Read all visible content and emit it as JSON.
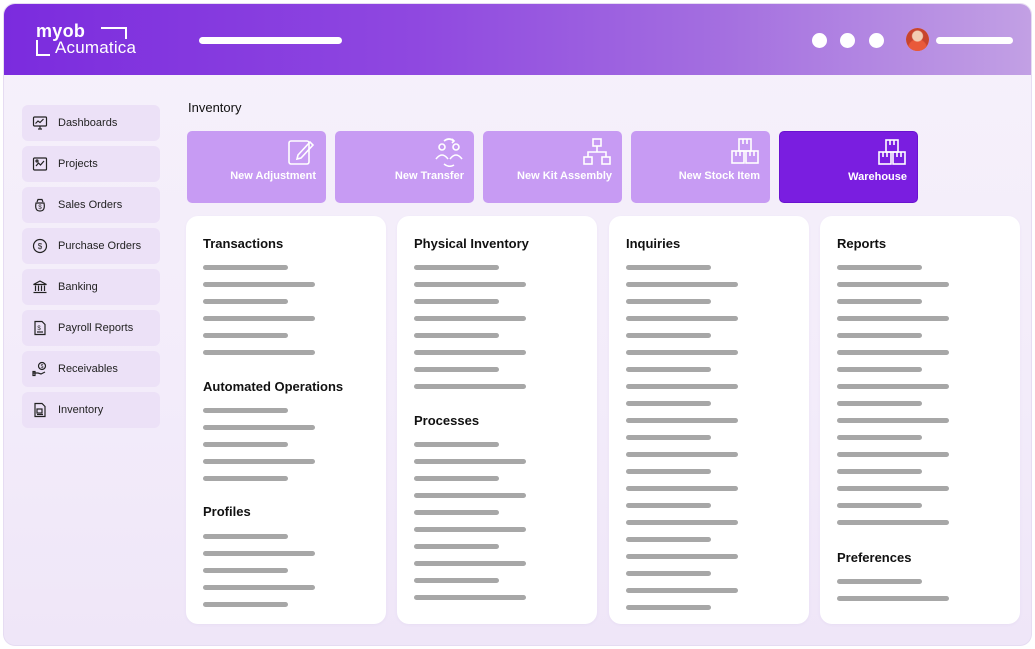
{
  "brand": {
    "line1": "myob",
    "line2": "Acumatica"
  },
  "colors": {
    "accent": "#7a1ee0",
    "tile": "#c79bf3",
    "sidebar_item": "#ece1f7"
  },
  "sidebar": {
    "items": [
      {
        "label": "Dashboards",
        "icon": "dashboard-icon"
      },
      {
        "label": "Projects",
        "icon": "projects-icon"
      },
      {
        "label": "Sales Orders",
        "icon": "sales-orders-icon"
      },
      {
        "label": "Purchase Orders",
        "icon": "dollar-circle-icon"
      },
      {
        "label": "Banking",
        "icon": "bank-icon"
      },
      {
        "label": "Payroll Reports",
        "icon": "document-dollar-icon"
      },
      {
        "label": "Receivables",
        "icon": "hand-coin-icon"
      },
      {
        "label": "Inventory",
        "icon": "inventory-icon"
      }
    ]
  },
  "main": {
    "title": "Inventory",
    "tiles": [
      {
        "label": "New Adjustment",
        "icon": "edit-icon"
      },
      {
        "label": "New Transfer",
        "icon": "transfer-icon"
      },
      {
        "label": "New Kit Assembly",
        "icon": "hierarchy-icon"
      },
      {
        "label": "New Stock Item",
        "icon": "boxes-icon"
      },
      {
        "label": "Warehouse",
        "icon": "warehouse-icon",
        "active": true
      }
    ],
    "cards": [
      {
        "sections": [
          "Transactions",
          "Automated Operations",
          "Profiles"
        ]
      },
      {
        "sections": [
          "Physical Inventory",
          "Processes"
        ]
      },
      {
        "sections": [
          "Inquiries"
        ]
      },
      {
        "sections": [
          "Reports",
          "Preferences"
        ]
      }
    ]
  }
}
